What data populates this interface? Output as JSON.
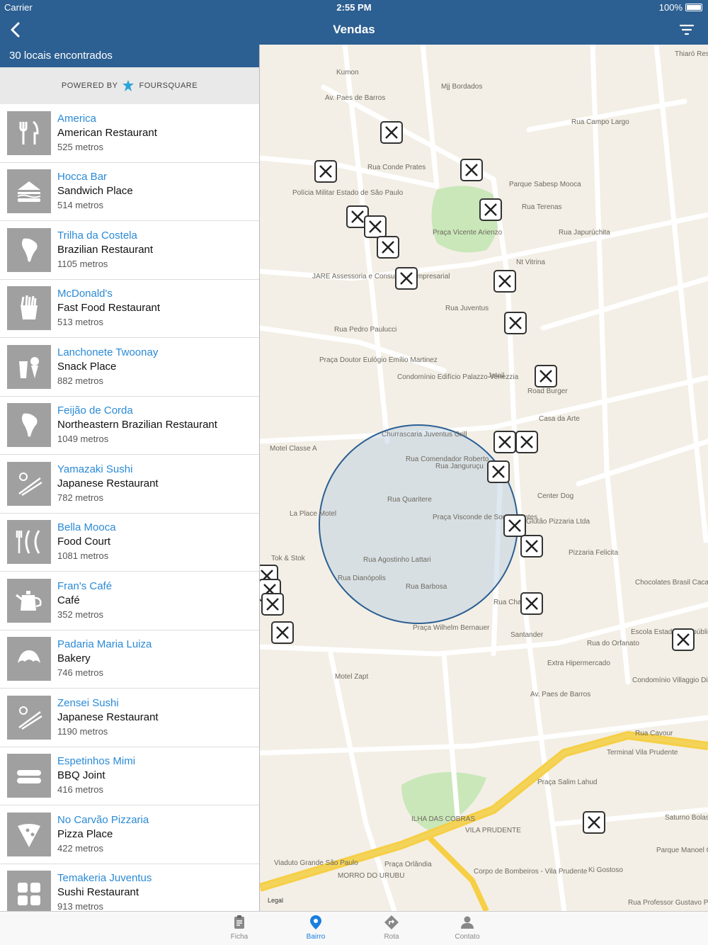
{
  "status": {
    "carrier": "Carrier",
    "time": "2:55 PM",
    "battery": "100%"
  },
  "nav": {
    "title": "Vendas"
  },
  "summary": "30 locais encontrados",
  "powered": {
    "prefix": "POWERED BY",
    "brand": "FOURSQUARE"
  },
  "places": [
    {
      "name": "America",
      "category": "American Restaurant",
      "distance": "525 metros",
      "icon": "fork-knife-icon"
    },
    {
      "name": "Hocca Bar",
      "category": "Sandwich Place",
      "distance": "514 metros",
      "icon": "sandwich-icon"
    },
    {
      "name": "Trilha da Costela",
      "category": "Brazilian Restaurant",
      "distance": "1105 metros",
      "icon": "south-america-icon"
    },
    {
      "name": "McDonald's",
      "category": "Fast Food Restaurant",
      "distance": "513 metros",
      "icon": "fries-icon"
    },
    {
      "name": "Lanchonete Twoonay",
      "category": "Snack Place",
      "distance": "882 metros",
      "icon": "snack-icon"
    },
    {
      "name": "Feijão de Corda",
      "category": "Northeastern Brazilian Restaurant",
      "distance": "1049 metros",
      "icon": "south-america-icon"
    },
    {
      "name": "Yamazaki Sushi",
      "category": "Japanese Restaurant",
      "distance": "782 metros",
      "icon": "chopsticks-icon"
    },
    {
      "name": "Bella Mooca",
      "category": "Food Court",
      "distance": "1081 metros",
      "icon": "food-court-icon"
    },
    {
      "name": "Fran's Café",
      "category": "Café",
      "distance": "352 metros",
      "icon": "teapot-icon"
    },
    {
      "name": "Padaria Maria Luiza",
      "category": "Bakery",
      "distance": "746 metros",
      "icon": "croissant-icon"
    },
    {
      "name": "Zensei Sushi",
      "category": "Japanese Restaurant",
      "distance": "1190 metros",
      "icon": "chopsticks-icon"
    },
    {
      "name": "Espetinhos Mimi",
      "category": "BBQ Joint",
      "distance": "416 metros",
      "icon": "sausage-icon"
    },
    {
      "name": "No Carvão Pizzaria",
      "category": "Pizza Place",
      "distance": "422 metros",
      "icon": "pizza-icon"
    },
    {
      "name": "Temakeria Juventus",
      "category": "Sushi Restaurant",
      "distance": "913 metros",
      "icon": "sushi-icon"
    }
  ],
  "map": {
    "labels": [
      "Kumon",
      "Mjj Bordados",
      "Av. Paes de Barros",
      "Rua Conde Prates",
      "Rua Campo Largo",
      "Parque Sabesp Mooca",
      "Rua Terenas",
      "Polícia Militar Estado de São Paulo",
      "Praça Vicente Arienzo",
      "Rua Japurúchita",
      "Nt Vitrina",
      "JARE Assessoria e Consultoria Empresarial",
      "Rua Pedro Paulucci",
      "Rua Juventus",
      "Praça Doutor Eulógio Emílio Martinez",
      "Condomínio Edifício Palazzo Venezzia",
      "Jetoil",
      "Road Burger",
      "Casa da Arte",
      "Motel Classe A",
      "Churrascaria Juventus Grill",
      "Rua Comendador Roberto",
      "Rua Janguruçu",
      "Rua Quaritere",
      "Center Dog",
      "La Place Motel",
      "Praça Visconde de Souza Fontes",
      "Glutão Pizzaria Ltda",
      "Tok & Stok",
      "Pizzaria Felicita",
      "Rua Dianópolis",
      "Rua Agostinho Lattari",
      "Rua Barbosa",
      "Rua Chamantá",
      "Chocolates Brasil Cacau",
      "Praça Wilhelm Bernauer",
      "Santander",
      "Rua do Orfanato",
      "Escola Estadual República do Paraguay",
      "Motel Zapt",
      "Extra Hipermercado",
      "Condomínio Villaggio Di Torino",
      "Av. Paes de Barros",
      "Rua Cavour",
      "Terminal Vila Prudente",
      "Praça Salim Lahud",
      "ILHA DAS COBRAS",
      "VILA PRUDENTE",
      "Praça Orlândia",
      "Corpo de Bombeiros - Vila Prudente",
      "MORRO DO URUBU",
      "Parque Manoel Galan",
      "Saturno Bolas",
      "Ki Gostoso",
      "Rua Professor Gustavo Pi",
      "Viaduto Grande São Paulo",
      "Thiaró Restaurante"
    ],
    "legal": "Legal"
  },
  "tabs": [
    {
      "label": "Ficha",
      "icon": "clipboard-icon"
    },
    {
      "label": "Bairro",
      "icon": "location-pin-icon"
    },
    {
      "label": "Rota",
      "icon": "route-icon"
    },
    {
      "label": "Contato",
      "icon": "person-icon"
    }
  ],
  "colors": {
    "accent": "#2c5f92",
    "link": "#2a8ad6",
    "tab_active": "#1a7ee0"
  }
}
